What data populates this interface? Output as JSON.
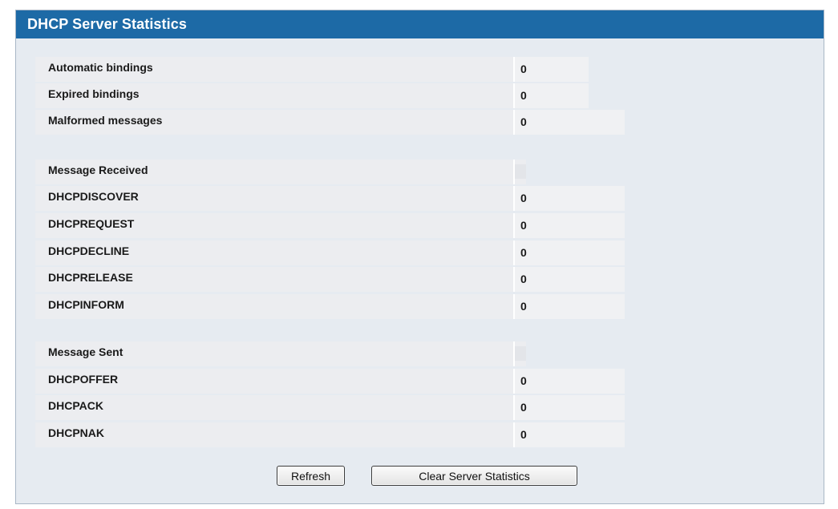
{
  "panel": {
    "title": "DHCP Server Statistics"
  },
  "general": [
    {
      "label": "Automatic bindings",
      "value": "0"
    },
    {
      "label": "Expired bindings",
      "value": "0"
    },
    {
      "label": "Malformed messages",
      "value": "0"
    }
  ],
  "received": {
    "header": "Message Received",
    "items": [
      {
        "label": "DHCPDISCOVER",
        "value": "0"
      },
      {
        "label": "DHCPREQUEST",
        "value": "0"
      },
      {
        "label": "DHCPDECLINE",
        "value": "0"
      },
      {
        "label": "DHCPRELEASE",
        "value": "0"
      },
      {
        "label": "DHCPINFORM",
        "value": "0"
      }
    ]
  },
  "sent": {
    "header": "Message Sent",
    "items": [
      {
        "label": "DHCPOFFER",
        "value": "0"
      },
      {
        "label": "DHCPACK",
        "value": "0"
      },
      {
        "label": "DHCPNAK",
        "value": "0"
      }
    ]
  },
  "buttons": {
    "refresh": "Refresh",
    "clear": "Clear Server Statistics"
  }
}
